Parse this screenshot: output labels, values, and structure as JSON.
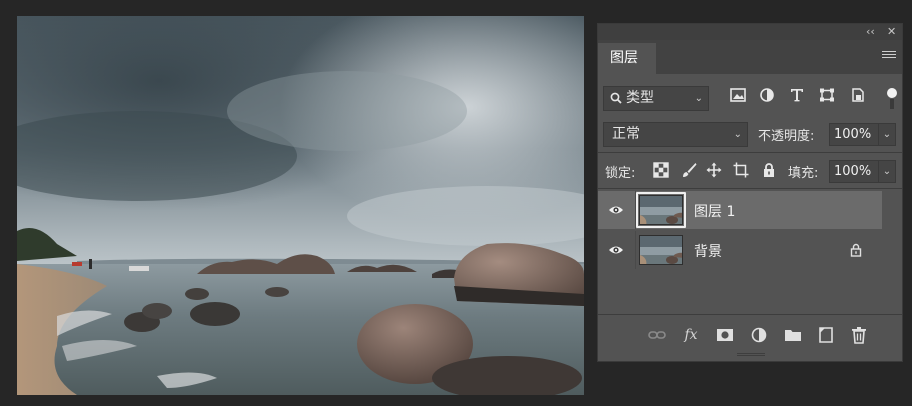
{
  "canvas": {
    "description_icon": "photo-canvas"
  },
  "panel": {
    "collapse_label": "‹‹",
    "close_label": "✕",
    "tab_label": "图层",
    "filter": {
      "kind_label": "类型",
      "icons": [
        "image-filter-icon",
        "adjustment-filter-icon",
        "type-filter-icon",
        "shape-filter-icon",
        "smart-object-filter-icon"
      ]
    },
    "blend_mode": "正常",
    "opacity": {
      "label": "不透明度:",
      "value": "100%"
    },
    "lock": {
      "label": "锁定:",
      "icons": [
        "lock-transparent-icon",
        "lock-pixels-icon",
        "lock-position-icon",
        "lock-artboard-icon",
        "lock-all-icon"
      ]
    },
    "fill": {
      "label": "填充:",
      "value": "100%"
    },
    "layers": [
      {
        "name": "图层 1",
        "selected": true,
        "visible": true,
        "locked": false
      },
      {
        "name": "背景",
        "selected": false,
        "visible": true,
        "locked": true
      }
    ],
    "bottom_icons": [
      "link-icon",
      "fx-icon",
      "mask-icon",
      "adjustment-layer-icon",
      "group-folder-icon",
      "new-layer-icon",
      "trash-icon"
    ],
    "fx_label": "fx"
  },
  "colors": {
    "panel_bg": "#535353",
    "selected_row": "#6b6b6b",
    "app_bg": "#262626"
  }
}
